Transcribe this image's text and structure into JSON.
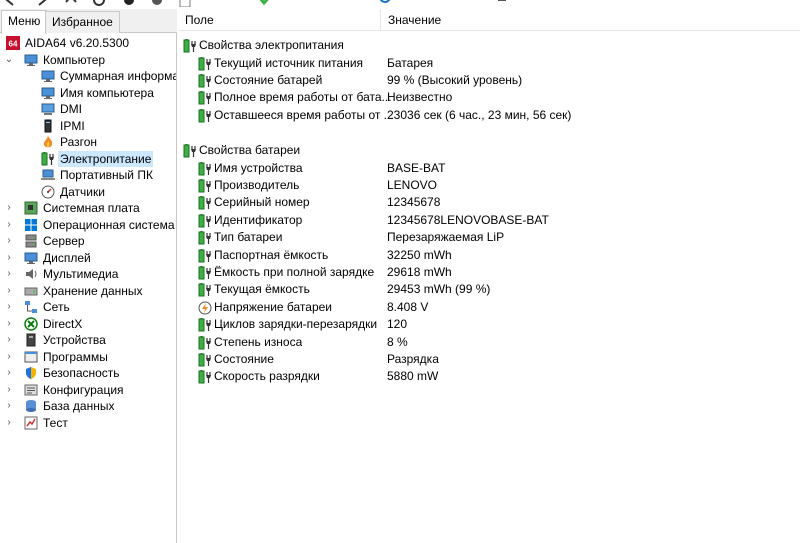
{
  "tabs": {
    "menu": "Меню",
    "favorites": "Избранное"
  },
  "tree": [
    {
      "label": "AIDA64 v6.20.5300",
      "icon": "aida64-icon",
      "level": 0,
      "arrow": ""
    },
    {
      "label": "Компьютер",
      "icon": "computer-icon",
      "level": 0,
      "arrow": "expanded"
    },
    {
      "label": "Суммарная информа",
      "icon": "summary-icon",
      "level": 1,
      "arrow": ""
    },
    {
      "label": "Имя компьютера",
      "icon": "computer-name-icon",
      "level": 1,
      "arrow": ""
    },
    {
      "label": "DMI",
      "icon": "dmi-icon",
      "level": 1,
      "arrow": ""
    },
    {
      "label": "IPMI",
      "icon": "ipmi-icon",
      "level": 1,
      "arrow": ""
    },
    {
      "label": "Разгон",
      "icon": "overclock-flame-icon",
      "level": 1,
      "arrow": ""
    },
    {
      "label": "Электропитание",
      "icon": "battery-icon",
      "level": 1,
      "arrow": "",
      "selected": true
    },
    {
      "label": "Портативный ПК",
      "icon": "laptop-icon",
      "level": 1,
      "arrow": ""
    },
    {
      "label": "Датчики",
      "icon": "sensor-gauge-icon",
      "level": 1,
      "arrow": ""
    },
    {
      "label": "Системная плата",
      "icon": "motherboard-icon",
      "level": 0,
      "arrow": "collapsed"
    },
    {
      "label": "Операционная система",
      "icon": "windows-icon",
      "level": 0,
      "arrow": "collapsed"
    },
    {
      "label": "Сервер",
      "icon": "server-icon",
      "level": 0,
      "arrow": "collapsed"
    },
    {
      "label": "Дисплей",
      "icon": "display-icon",
      "level": 0,
      "arrow": "collapsed"
    },
    {
      "label": "Мультимедиа",
      "icon": "multimedia-icon",
      "level": 0,
      "arrow": "collapsed"
    },
    {
      "label": "Хранение данных",
      "icon": "storage-icon",
      "level": 0,
      "arrow": "collapsed"
    },
    {
      "label": "Сеть",
      "icon": "network-icon",
      "level": 0,
      "arrow": "collapsed"
    },
    {
      "label": "DirectX",
      "icon": "directx-icon",
      "level": 0,
      "arrow": "collapsed"
    },
    {
      "label": "Устройства",
      "icon": "devices-icon",
      "level": 0,
      "arrow": "collapsed"
    },
    {
      "label": "Программы",
      "icon": "programs-icon",
      "level": 0,
      "arrow": "collapsed"
    },
    {
      "label": "Безопасность",
      "icon": "security-shield-icon",
      "level": 0,
      "arrow": "collapsed"
    },
    {
      "label": "Конфигурация",
      "icon": "config-icon",
      "level": 0,
      "arrow": "collapsed"
    },
    {
      "label": "База данных",
      "icon": "database-icon",
      "level": 0,
      "arrow": "collapsed"
    },
    {
      "label": "Тест",
      "icon": "test-icon",
      "level": 0,
      "arrow": "collapsed"
    }
  ],
  "columns": {
    "field": "Поле",
    "value": "Значение"
  },
  "rows": [
    {
      "kind": "group",
      "field": "Свойства электропитания",
      "value": "",
      "icon": "battery-plug-icon"
    },
    {
      "kind": "item",
      "field": "Текущий источник питания",
      "value": "Батарея",
      "icon": "battery-plug-icon"
    },
    {
      "kind": "item",
      "field": "Состояние батарей",
      "value": "99 % (Высокий уровень)",
      "icon": "battery-plug-icon"
    },
    {
      "kind": "item",
      "field": "Полное время работы от бата...",
      "value": "Неизвестно",
      "icon": "battery-plug-icon"
    },
    {
      "kind": "item",
      "field": "Оставшееся время работы от ...",
      "value": "23036 сек (6 час., 23 мин, 56 сек)",
      "icon": "battery-plug-icon"
    },
    {
      "kind": "spacer"
    },
    {
      "kind": "group",
      "field": "Свойства батареи",
      "value": "",
      "icon": "battery-plug-icon"
    },
    {
      "kind": "item",
      "field": "Имя устройства",
      "value": "BASE-BAT",
      "icon": "battery-plug-icon"
    },
    {
      "kind": "item",
      "field": "Производитель",
      "value": "LENOVO",
      "icon": "battery-plug-icon"
    },
    {
      "kind": "item",
      "field": "Серийный номер",
      "value": "12345678",
      "icon": "battery-plug-icon"
    },
    {
      "kind": "item",
      "field": "Идентификатор",
      "value": "12345678LENOVOBASE-BAT",
      "icon": "battery-plug-icon"
    },
    {
      "kind": "item",
      "field": "Тип батареи",
      "value": "Перезаряжаемая LiP",
      "icon": "battery-plug-icon"
    },
    {
      "kind": "item",
      "field": "Паспортная ёмкость",
      "value": "32250 mWh",
      "icon": "battery-plug-icon"
    },
    {
      "kind": "item",
      "field": "Ёмкость при полной зарядке",
      "value": "29618 mWh",
      "icon": "battery-plug-icon"
    },
    {
      "kind": "item",
      "field": "Текущая ёмкость",
      "value": "29453 mWh  (99 %)",
      "icon": "battery-plug-icon"
    },
    {
      "kind": "item",
      "field": "Напряжение батареи",
      "value": "8.408 V",
      "icon": "voltage-icon"
    },
    {
      "kind": "item",
      "field": "Циклов зарядки-перезарядки",
      "value": "120",
      "icon": "battery-plug-icon"
    },
    {
      "kind": "item",
      "field": "Степень износа",
      "value": "8 %",
      "icon": "battery-plug-icon"
    },
    {
      "kind": "item",
      "field": "Состояние",
      "value": "Разрядка",
      "icon": "battery-plug-icon"
    },
    {
      "kind": "item",
      "field": "Скорость разрядки",
      "value": "5880 mW",
      "icon": "battery-plug-icon"
    }
  ],
  "colors": {
    "selection": "#cce8ff",
    "battery_green": "#3cb043",
    "aida_red": "#c8102e"
  }
}
